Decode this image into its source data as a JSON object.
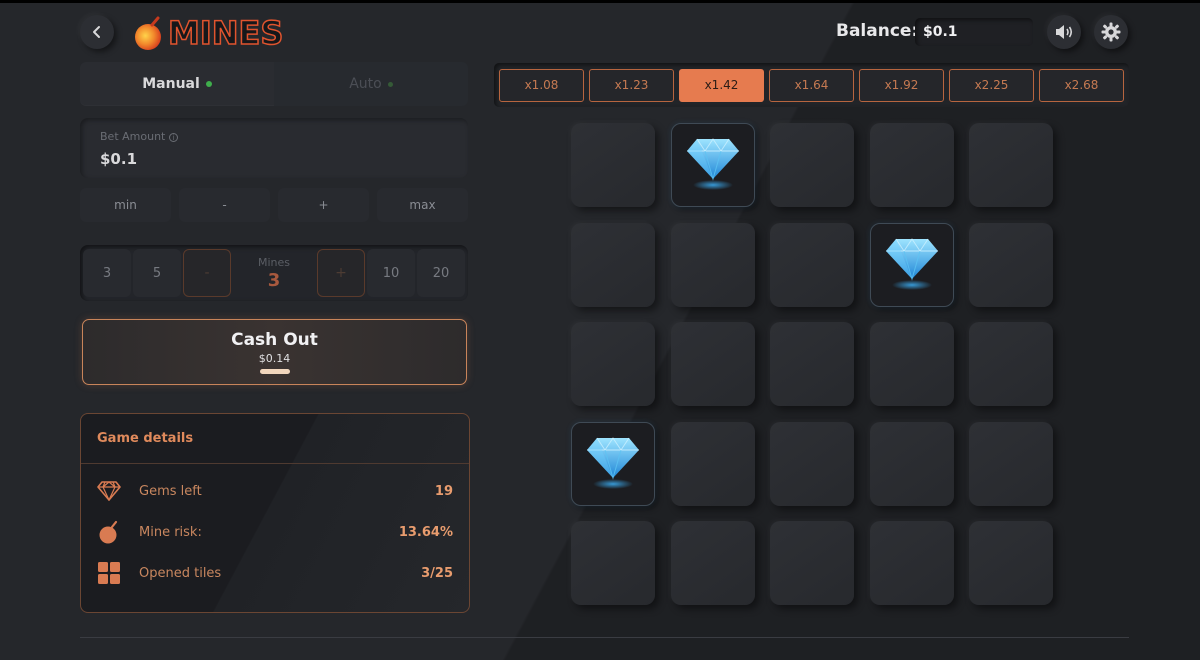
{
  "header": {
    "logo_text": "MINES",
    "balance_label": "Balance:",
    "balance_value": "$0.1"
  },
  "mode_tabs": [
    {
      "label": "Manual",
      "active": true
    },
    {
      "label": "Auto",
      "active": false
    }
  ],
  "bet": {
    "label": "Bet Amount",
    "value": "$0.1",
    "adjust_buttons": [
      "min",
      "-",
      "+",
      "max"
    ]
  },
  "mines_selector": {
    "presets_left": [
      "3",
      "5"
    ],
    "decrement": "-",
    "label": "Mines",
    "value": "3",
    "increment": "+",
    "presets_right": [
      "10",
      "20"
    ]
  },
  "cash_out": {
    "title": "Cash Out",
    "amount": "$0.14"
  },
  "game_details": {
    "title": "Game details",
    "rows": [
      {
        "icon": "diamond-icon",
        "label": "Gems left",
        "value": "19"
      },
      {
        "icon": "bomb-icon",
        "label": "Mine risk:",
        "value": "13.64%"
      },
      {
        "icon": "tiles-icon",
        "label": "Opened tiles",
        "value": "3/25"
      }
    ]
  },
  "multipliers": [
    "x1.08",
    "x1.23",
    "x1.42",
    "x1.64",
    "x1.92",
    "x2.25",
    "x2.68"
  ],
  "active_multiplier_index": 2,
  "board": {
    "rows": 5,
    "cols": 5,
    "revealed_gems": [
      [
        0,
        1
      ],
      [
        1,
        3
      ],
      [
        3,
        0
      ]
    ]
  },
  "colors": {
    "accent": "#e67b4f",
    "background": "#25272b",
    "gem": "#3aa6e8"
  }
}
